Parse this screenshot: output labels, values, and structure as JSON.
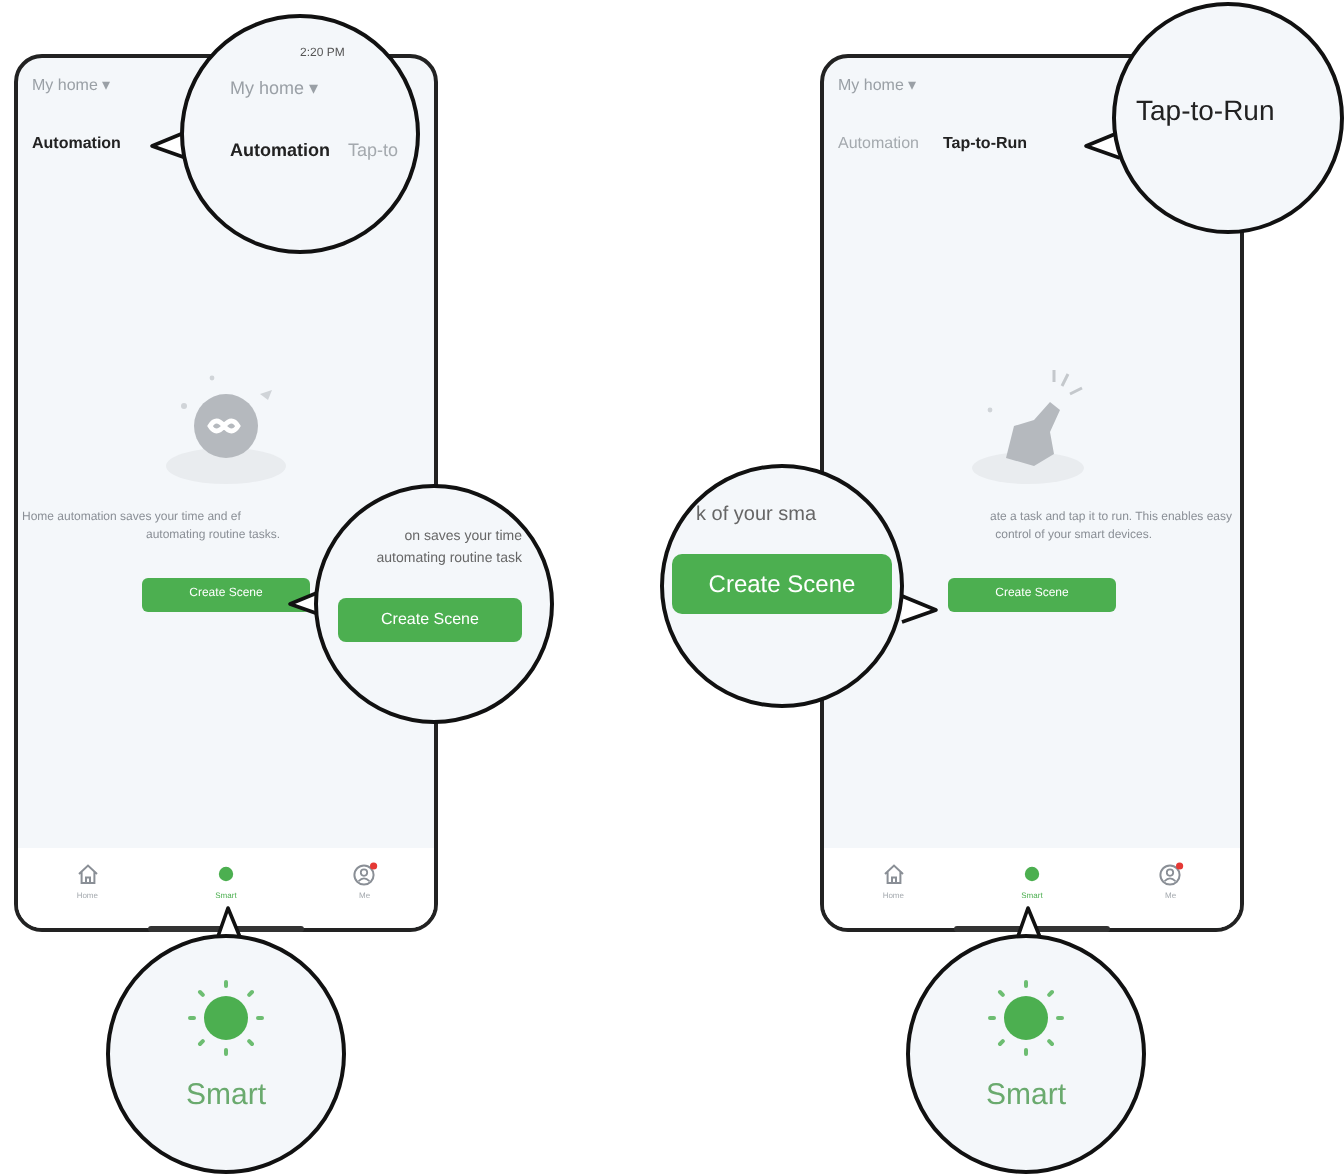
{
  "panels": [
    {
      "home_menu": "My home ▾",
      "tabs": [
        {
          "label": "Automation",
          "selected": true
        }
      ],
      "description": "Home automation saves your time and ef",
      "description_2": "automating routine tasks.",
      "button": "Create Scene",
      "nav": [
        {
          "label": "Home",
          "selected": false
        },
        {
          "label": "Smart",
          "selected": true
        },
        {
          "label": "Me",
          "selected": false
        }
      ],
      "magnifiers": [
        {
          "kind": "header",
          "time": "2:20 PM",
          "home_menu": "My home ▾",
          "tabs": [
            {
              "label": "Automation",
              "selected": true
            },
            {
              "label": "Tap-to",
              "selected": false
            }
          ]
        },
        {
          "kind": "button",
          "text_lines": [
            "on saves your time",
            "automating routine task"
          ],
          "button": "Create Scene"
        },
        {
          "kind": "nav",
          "label": "Smart"
        }
      ]
    },
    {
      "home_menu": "My home ▾",
      "tabs": [
        {
          "label": "Automation",
          "selected": false
        },
        {
          "label": "Tap-to-Run",
          "selected": true
        }
      ],
      "description": "ate a task and tap it to run. This enables easy",
      "description_2": "control of your smart devices.",
      "button": "Create Scene",
      "nav": [
        {
          "label": "Home",
          "selected": false
        },
        {
          "label": "Smart",
          "selected": true
        },
        {
          "label": "Me",
          "selected": false
        }
      ],
      "magnifiers": [
        {
          "kind": "tab",
          "label": "Tap-to-Run"
        },
        {
          "kind": "button",
          "text_lines": [
            "k of your sma"
          ],
          "button": "Create Scene"
        },
        {
          "kind": "nav",
          "label": "Smart"
        }
      ]
    }
  ]
}
